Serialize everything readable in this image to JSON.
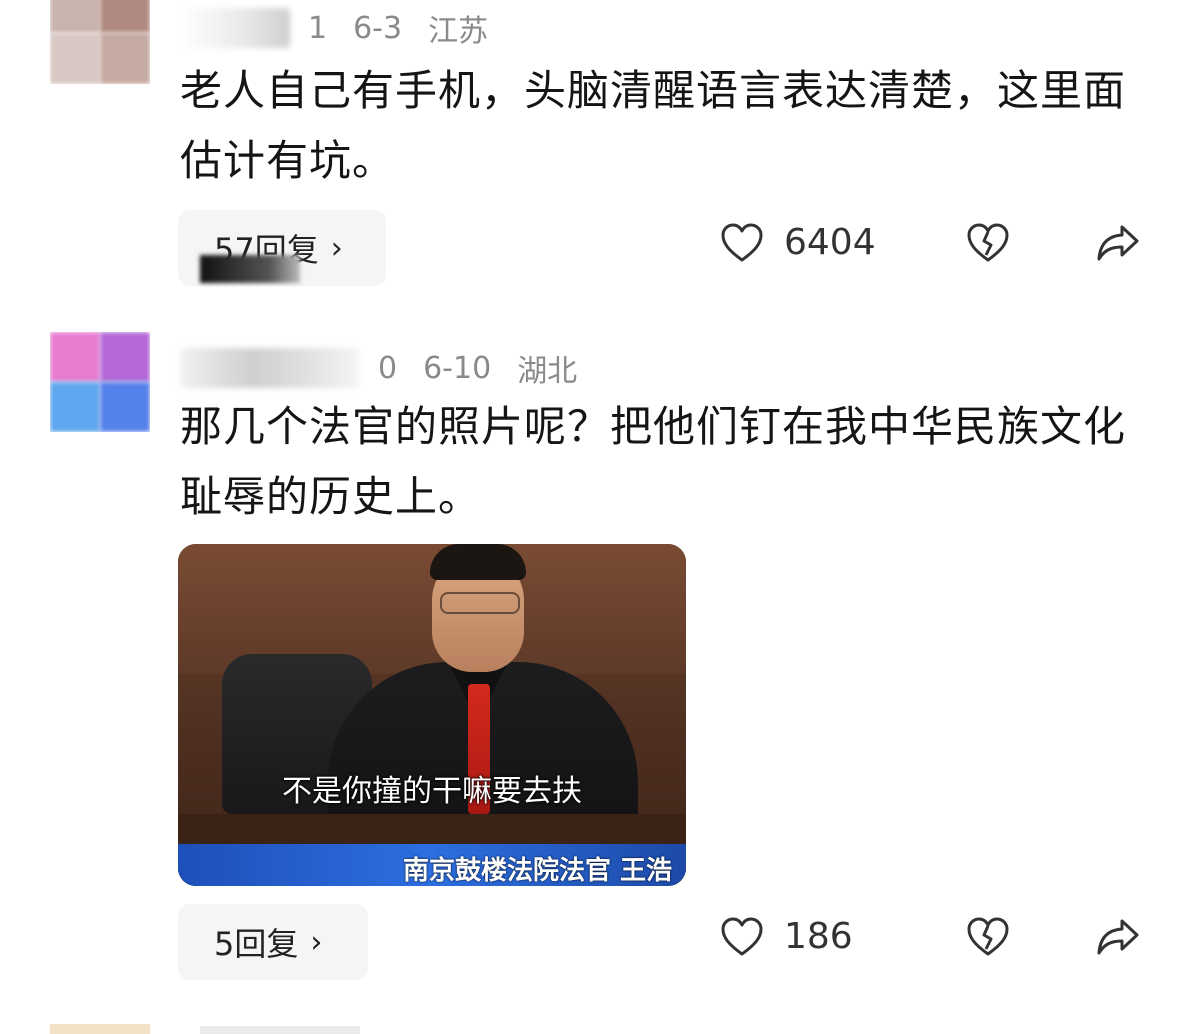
{
  "comments": [
    {
      "meta": {
        "name_tail": "1",
        "date": "6-3",
        "location": "江苏"
      },
      "text": "老人自己有手机，头脑清醒语言表达清楚，这里面估计有坑。",
      "reply_label": "57回复",
      "likes": "6404",
      "avatar_colors": [
        "#c9b3ae",
        "#b08a80",
        "#d8c7c2",
        "#c5a9a2"
      ]
    },
    {
      "meta": {
        "name_tail": "0",
        "date": "6-10",
        "location": "湖北"
      },
      "text": "那几个法官的照片呢？把他们钉在我中华民族文化耻辱的历史上。",
      "reply_label": "5回复",
      "likes": "186",
      "avatar_colors": [
        "#e77bd0",
        "#b569d6",
        "#5ea6ee",
        "#5581ea"
      ],
      "media": {
        "subtitle": "不是你撞的干嘛要去扶",
        "caption": "南京鼓楼法院法官  王浩"
      }
    }
  ],
  "icons": {
    "like": "heart-outline-icon",
    "dislike": "broken-heart-icon",
    "share": "share-arrow-icon",
    "chevron": "›"
  },
  "colors": {
    "text": "#151515",
    "meta": "#8a8a8a",
    "reply_bg": "#f5f5f5"
  }
}
